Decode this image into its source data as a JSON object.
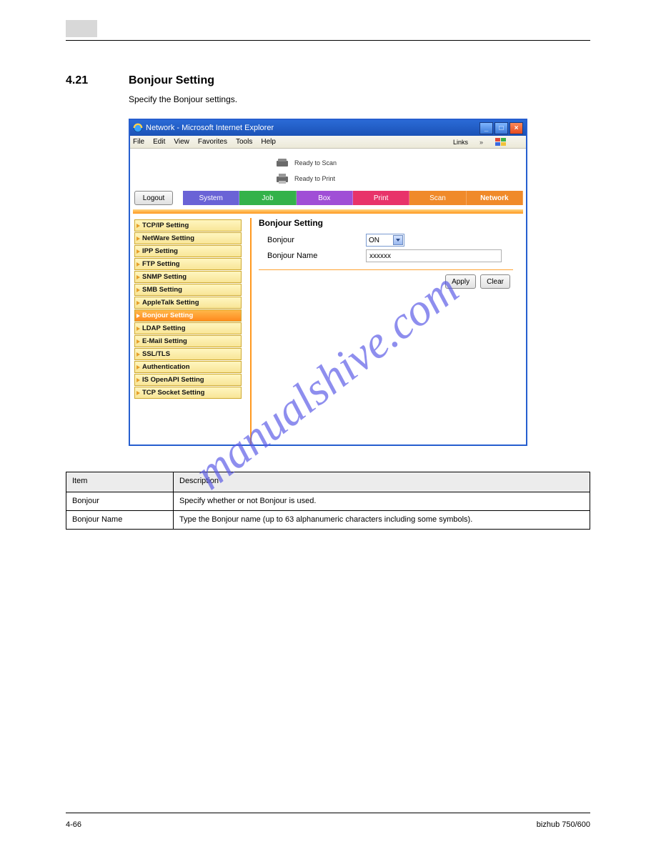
{
  "page": {
    "section_no": "4.21",
    "section_title": "Bonjour Setting",
    "description": "Specify the Bonjour settings.",
    "footer_page": "4-66",
    "footer_model": "bizhub 750/600"
  },
  "browser": {
    "title": "Network - Microsoft Internet Explorer",
    "menus": [
      "File",
      "Edit",
      "View",
      "Favorites",
      "Tools",
      "Help"
    ],
    "links_label": "Links"
  },
  "status": {
    "scan": "Ready to Scan",
    "print": "Ready to Print"
  },
  "tabs": {
    "logout": "Logout",
    "system": "System",
    "job": "Job",
    "box": "Box",
    "print": "Print",
    "scan": "Scan",
    "network": "Network"
  },
  "sidebar": {
    "items": [
      "TCP/IP Setting",
      "NetWare Setting",
      "IPP Setting",
      "FTP Setting",
      "SNMP Setting",
      "SMB Setting",
      "AppleTalk Setting",
      "Bonjour Setting",
      "LDAP Setting",
      "E-Mail Setting",
      "SSL/TLS",
      "Authentication",
      "IS OpenAPI Setting",
      "TCP Socket Setting"
    ],
    "selected_index": 7
  },
  "form": {
    "title": "Bonjour Setting",
    "bonjour_label": "Bonjour",
    "bonjour_value": "ON",
    "bonjour_name_label": "Bonjour Name",
    "bonjour_name_value": "xxxxxx",
    "apply": "Apply",
    "clear": "Clear"
  },
  "table": {
    "head_item": "Item",
    "head_desc": "Description",
    "rows": [
      {
        "item": "Bonjour",
        "desc": "Specify whether or not Bonjour is used."
      },
      {
        "item": "Bonjour Name",
        "desc": "Type the Bonjour name (up to 63 alphanumeric characters including some symbols)."
      }
    ]
  },
  "watermark": "manualshive.com"
}
